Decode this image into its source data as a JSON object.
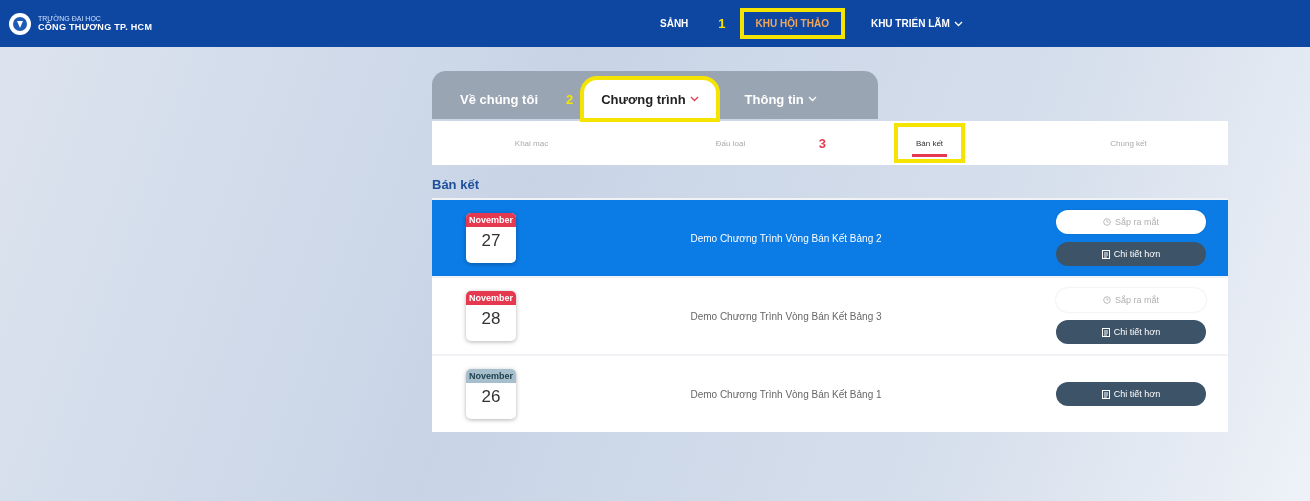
{
  "header": {
    "logo": {
      "line_1": "TRƯỜNG ĐẠI HỌC",
      "line_2": "CÔNG THƯƠNG TP. HCM"
    },
    "nav": [
      {
        "label": "SẢNH",
        "selected": false,
        "annotation": "1",
        "highlighted": false,
        "dropdown": false
      },
      {
        "label": "KHU HỘI THẢO",
        "selected": true,
        "highlighted": true,
        "dropdown": false
      },
      {
        "label": "KHU TRIỂN LÃM",
        "selected": false,
        "highlighted": false,
        "dropdown": true
      }
    ]
  },
  "tabs": [
    {
      "label": "Về chúng tôi",
      "selected": false,
      "dropdown": false,
      "highlighted": false,
      "annotation": "2"
    },
    {
      "label": "Chương trình",
      "selected": true,
      "dropdown": true,
      "highlighted": true
    },
    {
      "label": "Thông tin",
      "selected": false,
      "dropdown": true,
      "highlighted": false
    }
  ],
  "subtabs": [
    {
      "label": "Khai mạc",
      "selected": false,
      "highlighted": false
    },
    {
      "label": "Đấu loại",
      "selected": false,
      "highlighted": false,
      "annotation": "3"
    },
    {
      "label": "Bán kết",
      "selected": true,
      "highlighted": true
    },
    {
      "label": "Chung kết",
      "selected": false,
      "highlighted": false
    }
  ],
  "section_title": "Bán kết",
  "events": [
    {
      "month": "November",
      "day": "27",
      "title": "Demo Chương Trình Vòng Bán Kết Bảng 2",
      "selected": true,
      "past": false,
      "status": "Sắp ra mắt",
      "details": "Chi tiết hơn"
    },
    {
      "month": "November",
      "day": "28",
      "title": "Demo Chương Trình Vòng Bán Kết Bảng 3",
      "selected": false,
      "past": false,
      "status": "Sắp ra mắt",
      "details": "Chi tiết hơn"
    },
    {
      "month": "November",
      "day": "26",
      "title": "Demo Chương Trình Vòng Bán Kết Bảng 1",
      "selected": false,
      "past": true,
      "details": "Chi tiết hơn"
    }
  ]
}
